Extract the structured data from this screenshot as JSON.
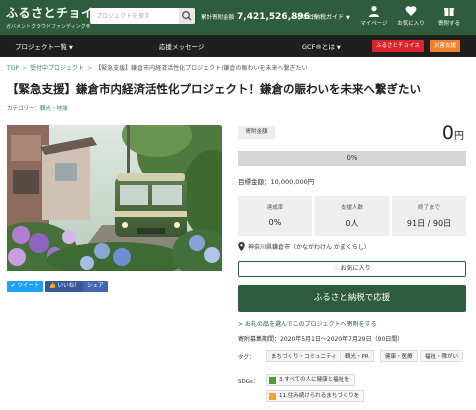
{
  "header": {
    "logo_main": "ふるさとチョイス",
    "logo_sub": "ガバメントクラウドファンディング®",
    "search_placeholder": "プロジェクトを探す",
    "donation_label": "累計寄附金額",
    "donation_amount": "7,421,526,896",
    "donation_unit": "円",
    "guide_label": "ふるさと納税ガイド",
    "mypage_label": "マイページ",
    "favorites_label": "お気に入り",
    "history_label": "寄附する"
  },
  "subnav": {
    "projects": "プロジェクト一覧",
    "messages": "応援メッセージ",
    "gcf": "GCF®とは",
    "choice_tag": "ふるさとチョイス",
    "disaster_tag": "災害支援",
    "colors": {
      "choice": "#d9252b",
      "disaster": "#f0832f"
    }
  },
  "breadcrumb": {
    "top": "TOP",
    "category": "受付中プロジェクト",
    "current": "【緊急支援】鎌倉市内経済活性化プロジェクト!鎌倉の賑わいを未来へ繋ぎたい"
  },
  "project": {
    "title": "【緊急支援】鎌倉市内経済活性化プロジェクト！鎌倉の賑わいを未来へ繋ぎたい",
    "category_prefix": "カテゴリー：",
    "category": "観光・地域"
  },
  "share": {
    "tweet": "ツイート",
    "like": "いいね！",
    "share": "シェア"
  },
  "funding": {
    "support_label": "寄附金額",
    "amount": "0",
    "unit": "円",
    "progress_percent": 0,
    "progress_text": "0%",
    "goal": "目標金額：10,000,000円",
    "stats": [
      {
        "label": "達成率",
        "value": "0%"
      },
      {
        "label": "支援人数",
        "value": "0人"
      },
      {
        "label": "終了まで",
        "value": "91日 / 90日"
      }
    ],
    "location": "神奈川県鎌倉市（かながわけん かまくらし）",
    "favorite_btn": "お気に入り",
    "support_btn": "ふるさと納税で応援",
    "gift_link": "お礼の品を選んでこのプロジェクトへ寄附をする",
    "period": "寄附募集期間：2020年5月1日～2020年7月29日（90日間）"
  },
  "tags": {
    "label": "タグ：",
    "items": [
      "まちづくり・コミュニティ",
      "観光・PR",
      "健康・医療",
      "福祉・障がい"
    ]
  },
  "sdgs": {
    "label": "SDGs：",
    "items": [
      {
        "label": "3.すべての人に健康と福祉を",
        "color": "#4c9f38"
      },
      {
        "label": "11.住み続けられるまちづくりを",
        "color": "#fd9d24"
      }
    ]
  },
  "colors": {
    "brand_green": "#2e5c3c",
    "subnav_bg": "#1f1f1f",
    "twitter": "#1da1f2",
    "facebook_like": "#3b5998",
    "facebook_share": "#4267b2"
  }
}
